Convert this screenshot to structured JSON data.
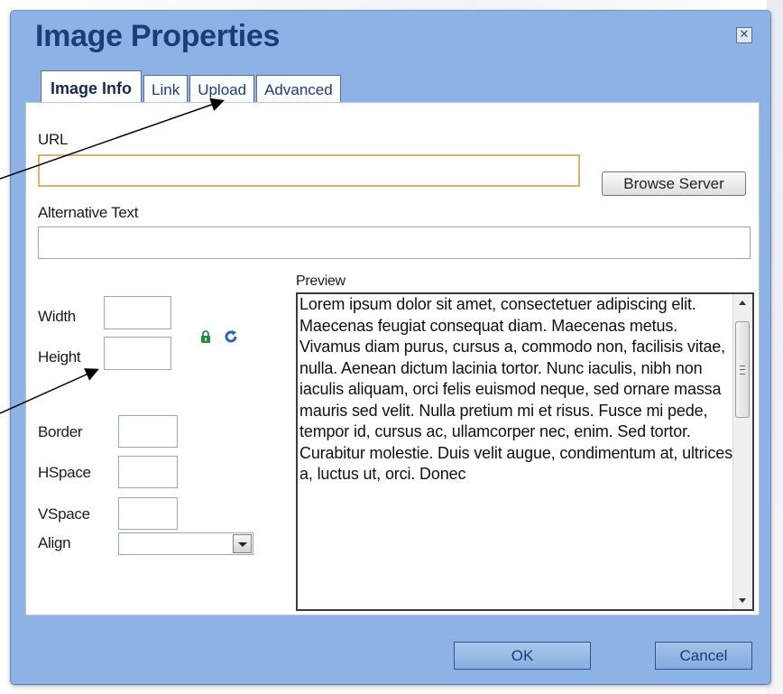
{
  "dialog": {
    "title": "Image Properties",
    "close_icon": "close-icon"
  },
  "tabs": [
    {
      "label": "Image Info",
      "active": true
    },
    {
      "label": "Link",
      "active": false
    },
    {
      "label": "Upload",
      "active": false
    },
    {
      "label": "Advanced",
      "active": false
    }
  ],
  "fields": {
    "url_label": "URL",
    "url_value": "",
    "browse_label": "Browse Server",
    "alt_label": "Alternative Text",
    "alt_value": "",
    "width_label": "Width",
    "width_value": "",
    "height_label": "Height",
    "height_value": "",
    "border_label": "Border",
    "border_value": "",
    "hspace_label": "HSpace",
    "hspace_value": "",
    "vspace_label": "VSpace",
    "vspace_value": "",
    "align_label": "Align",
    "align_value": ""
  },
  "preview": {
    "label": "Preview",
    "text": "Lorem ipsum dolor sit amet, consectetuer adipiscing elit. Maecenas feugiat consequat diam. Maecenas metus. Vivamus diam purus, cursus a, commodo non, facilisis vitae, nulla. Aenean dictum lacinia tortor. Nunc iaculis, nibh non iaculis aliquam, orci felis euismod neque, sed ornare massa mauris sed velit. Nulla pretium mi et risus. Fusce mi pede, tempor id, cursus ac, ullamcorper nec, enim. Sed tortor. Curabitur molestie. Duis velit augue, condimentum at, ultrices a, luctus ut, orci. Donec"
  },
  "footer": {
    "ok_label": "OK",
    "cancel_label": "Cancel"
  },
  "icons": {
    "lock": "lock-icon",
    "reset_size": "reset-size-icon"
  },
  "colors": {
    "dialog_bg": "#8cb2e6",
    "title": "#1a3e7a",
    "url_border": "#e1b25c",
    "lock": "#1f8f3a",
    "reset": "#2d63b8"
  }
}
